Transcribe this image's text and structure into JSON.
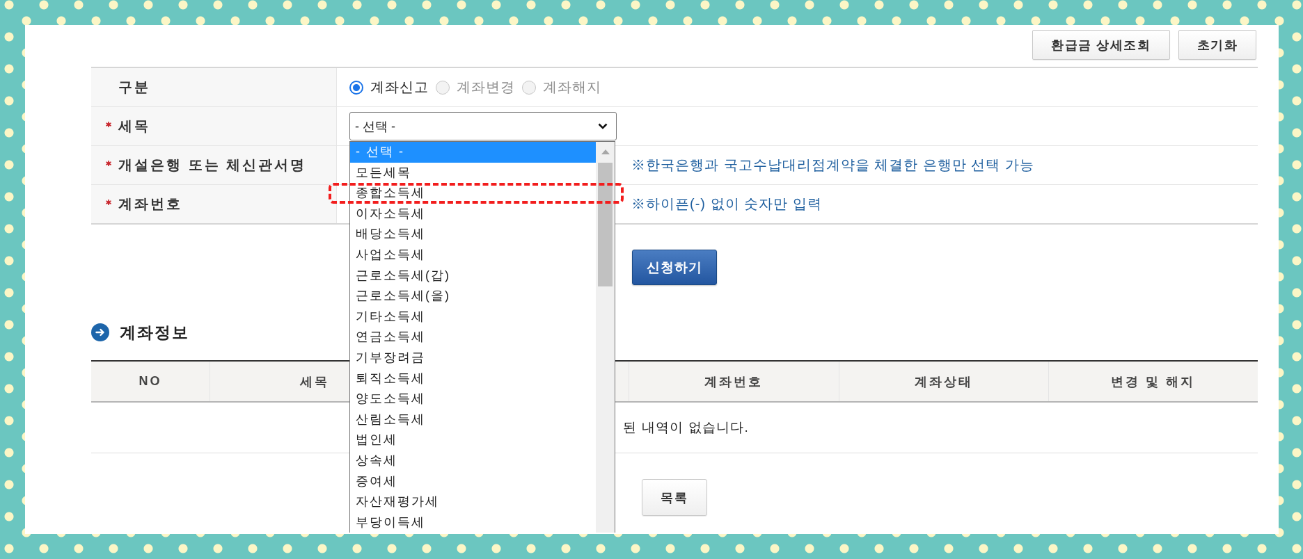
{
  "toolbar": {
    "buttons": [
      "환급금 상세조회",
      "초기화"
    ]
  },
  "form": {
    "rows": [
      {
        "kind": "radio",
        "label": "구분",
        "required": false,
        "options": [
          {
            "label": "계좌신고",
            "selected": true,
            "disabled": false
          },
          {
            "label": "계좌변경",
            "selected": false,
            "disabled": true
          },
          {
            "label": "계좌해지",
            "selected": false,
            "disabled": true
          }
        ]
      },
      {
        "kind": "select",
        "label": "세목",
        "required": true,
        "value": "- 선택 -",
        "expanded": true,
        "options": [
          {
            "label": "- 선택 -",
            "selected": true,
            "annotated": false
          },
          {
            "label": "모든세목",
            "selected": false,
            "annotated": false
          },
          {
            "label": "종합소득세",
            "selected": false,
            "annotated": true
          },
          {
            "label": "이자소득세",
            "selected": false,
            "annotated": false
          },
          {
            "label": "배당소득세",
            "selected": false,
            "annotated": false
          },
          {
            "label": "사업소득세",
            "selected": false,
            "annotated": false
          },
          {
            "label": "근로소득세(갑)",
            "selected": false,
            "annotated": false
          },
          {
            "label": "근로소득세(을)",
            "selected": false,
            "annotated": false
          },
          {
            "label": "기타소득세",
            "selected": false,
            "annotated": false
          },
          {
            "label": "연금소득세",
            "selected": false,
            "annotated": false
          },
          {
            "label": "기부장려금",
            "selected": false,
            "annotated": false
          },
          {
            "label": "퇴직소득세",
            "selected": false,
            "annotated": false
          },
          {
            "label": "양도소득세",
            "selected": false,
            "annotated": false
          },
          {
            "label": "산림소득세",
            "selected": false,
            "annotated": false
          },
          {
            "label": "법인세",
            "selected": false,
            "annotated": false
          },
          {
            "label": "상속세",
            "selected": false,
            "annotated": false
          },
          {
            "label": "증여세",
            "selected": false,
            "annotated": false
          },
          {
            "label": "자산재평가세",
            "selected": false,
            "annotated": false
          },
          {
            "label": "부당이득세",
            "selected": false,
            "annotated": false
          }
        ]
      },
      {
        "kind": "note",
        "label": "개설은행 또는 체신관서명",
        "required": true,
        "note": "※한국은행과 국고수납대리점계약을 체결한 은행만 선택 가능"
      },
      {
        "kind": "note",
        "label": "계좌번호",
        "required": true,
        "note": "※하이픈(-) 없이 숫자만 입력"
      }
    ]
  },
  "submit_button": "신청하기",
  "account_section": {
    "title": "계좌정보",
    "table": {
      "columns": [
        {
          "label": "NO"
        },
        {
          "label": "세목"
        },
        {},
        {
          "label": "계좌번호"
        },
        {
          "label": "계좌상태"
        },
        {
          "label": "변경 및 해지"
        }
      ],
      "empty_message": "된 내역이 없습니다."
    }
  },
  "list_button": "목록"
}
